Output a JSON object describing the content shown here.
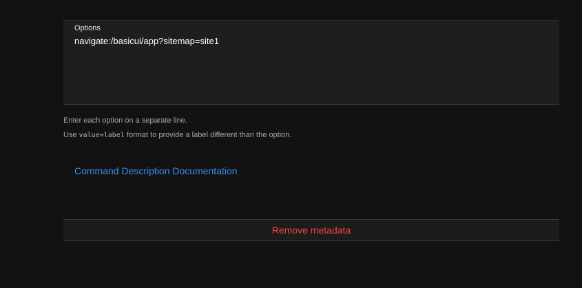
{
  "options_field": {
    "label": "Options",
    "value": "navigate:/basicui/app?sitemap=site1"
  },
  "hints": {
    "line1": "Enter each option on a separate line.",
    "line2_prefix": "Use ",
    "line2_code": "value=label",
    "line2_suffix": " format to provide a label different than the option."
  },
  "links": {
    "documentation": "Command Description Documentation"
  },
  "actions": {
    "remove_metadata": "Remove metadata"
  },
  "colors": {
    "background": "#121212",
    "field_background": "#1e1e1e",
    "link": "#3d8ef0",
    "danger": "#f0453a"
  }
}
